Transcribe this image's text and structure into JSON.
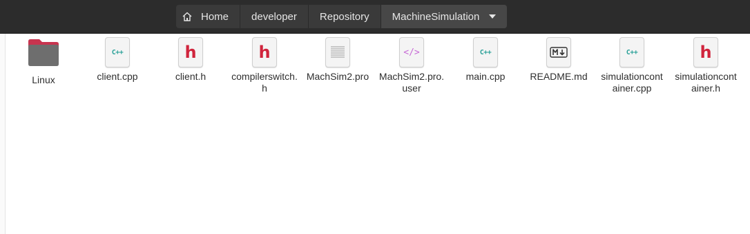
{
  "pathbar": {
    "home": "Home",
    "crumbs": [
      "developer",
      "Repository",
      "MachineSimulation"
    ]
  },
  "files": [
    {
      "name": "Linux",
      "icon": "folder-icon"
    },
    {
      "name": "client.cpp",
      "icon": "cpp-file-icon",
      "glyph": "C++"
    },
    {
      "name": "client.h",
      "icon": "header-file-icon",
      "glyph": "h"
    },
    {
      "name": "compilerswitch.h",
      "icon": "header-file-icon",
      "glyph": "h"
    },
    {
      "name": "MachSim2.pro",
      "icon": "text-file-icon"
    },
    {
      "name": "MachSim2.pro.user",
      "icon": "xml-file-icon",
      "glyph": "</>"
    },
    {
      "name": "main.cpp",
      "icon": "cpp-file-icon",
      "glyph": "C++"
    },
    {
      "name": "README.md",
      "icon": "markdown-file-icon",
      "glyph": "M↓"
    },
    {
      "name": "simulationcontainer.cpp",
      "icon": "cpp-file-icon",
      "glyph": "C++"
    },
    {
      "name": "simulationcontainer.h",
      "icon": "header-file-icon",
      "glyph": "h"
    }
  ],
  "colors": {
    "toolbar": "#2c2c2c",
    "folder": "#6e6e6e",
    "folder_tab": "#c8344f",
    "cpp": "#2aa198",
    "header": "#d0243c",
    "xml": "#c76ad6"
  }
}
